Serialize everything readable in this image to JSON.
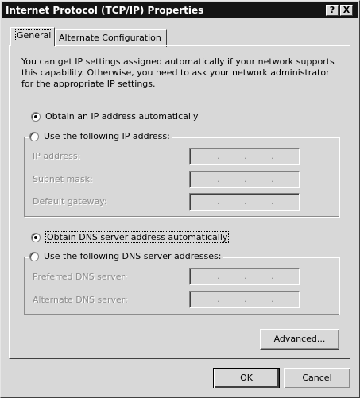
{
  "window": {
    "title": "Internet Protocol (TCP/IP) Properties",
    "help_glyph": "?",
    "close_glyph": "X"
  },
  "tabs": [
    {
      "label": "General",
      "selected": true
    },
    {
      "label": "Alternate Configuration",
      "selected": false
    }
  ],
  "description": "You can get IP settings assigned automatically if your network supports this capability. Otherwise, you need to ask your network administrator for the appropriate IP settings.",
  "ip_section": {
    "auto_option": {
      "label": "Obtain an IP address automatically",
      "checked": true
    },
    "manual_option": {
      "label": "Use the following IP address:",
      "checked": false
    },
    "fields": [
      {
        "label": "IP address:",
        "value": ""
      },
      {
        "label": "Subnet mask:",
        "value": ""
      },
      {
        "label": "Default gateway:",
        "value": ""
      }
    ]
  },
  "dns_section": {
    "auto_option": {
      "label": "Obtain DNS server address automatically",
      "checked": true
    },
    "manual_option": {
      "label": "Use the following DNS server addresses:",
      "checked": false
    },
    "fields": [
      {
        "label": "Preferred DNS server:",
        "value": ""
      },
      {
        "label": "Alternate DNS server:",
        "value": ""
      }
    ]
  },
  "buttons": {
    "advanced": "Advanced...",
    "ok": "OK",
    "cancel": "Cancel"
  },
  "ip_separator": ".",
  "colors": {
    "titlebar": "#141414",
    "face": "#d8d8d8",
    "disabled_text": "#8c8c8c"
  }
}
